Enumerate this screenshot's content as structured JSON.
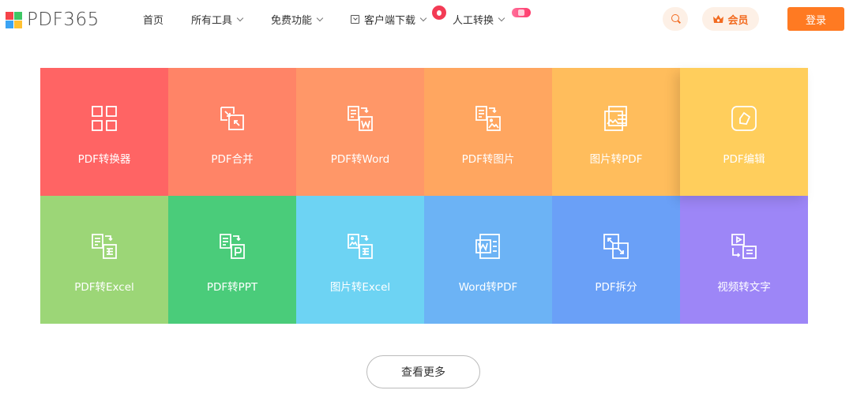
{
  "header": {
    "logo_text": "PDF365",
    "logo_colors": [
      "#f5434a",
      "#3ec764",
      "#3aa3f4",
      "#ffc131"
    ],
    "nav": [
      {
        "label": "首页"
      },
      {
        "label": "所有工具"
      },
      {
        "label": "免费功能"
      },
      {
        "label": "客户端下载"
      },
      {
        "label": "人工转换"
      }
    ],
    "vip_label": "会员",
    "login_label": "登录",
    "accent_color": "#ff7a22"
  },
  "tools": [
    {
      "label": "PDF转换器",
      "color": "#ff6464",
      "icon": "grid-icon"
    },
    {
      "label": "PDF合并",
      "color": "#ff8467",
      "icon": "merge-icon"
    },
    {
      "label": "PDF转Word",
      "color": "#ff9768",
      "icon": "pdf-to-word-icon"
    },
    {
      "label": "PDF转图片",
      "color": "#ffa660",
      "icon": "pdf-to-image-icon"
    },
    {
      "label": "图片转PDF",
      "color": "#ffbd5c",
      "icon": "image-to-pdf-icon"
    },
    {
      "label": "PDF编辑",
      "color": "#ffce5c",
      "icon": "edit-icon"
    },
    {
      "label": "PDF转Excel",
      "color": "#9cd677",
      "icon": "pdf-to-excel-icon"
    },
    {
      "label": "PDF转PPT",
      "color": "#4acc7a",
      "icon": "pdf-to-ppt-icon"
    },
    {
      "label": "图片转Excel",
      "color": "#6dd3f3",
      "icon": "image-to-excel-icon"
    },
    {
      "label": "Word转PDF",
      "color": "#6cb3f5",
      "icon": "word-to-pdf-icon"
    },
    {
      "label": "PDF拆分",
      "color": "#6aa0f7",
      "icon": "split-icon"
    },
    {
      "label": "视频转文字",
      "color": "#9d86f7",
      "icon": "video-to-text-icon"
    }
  ],
  "more_label": "查看更多"
}
